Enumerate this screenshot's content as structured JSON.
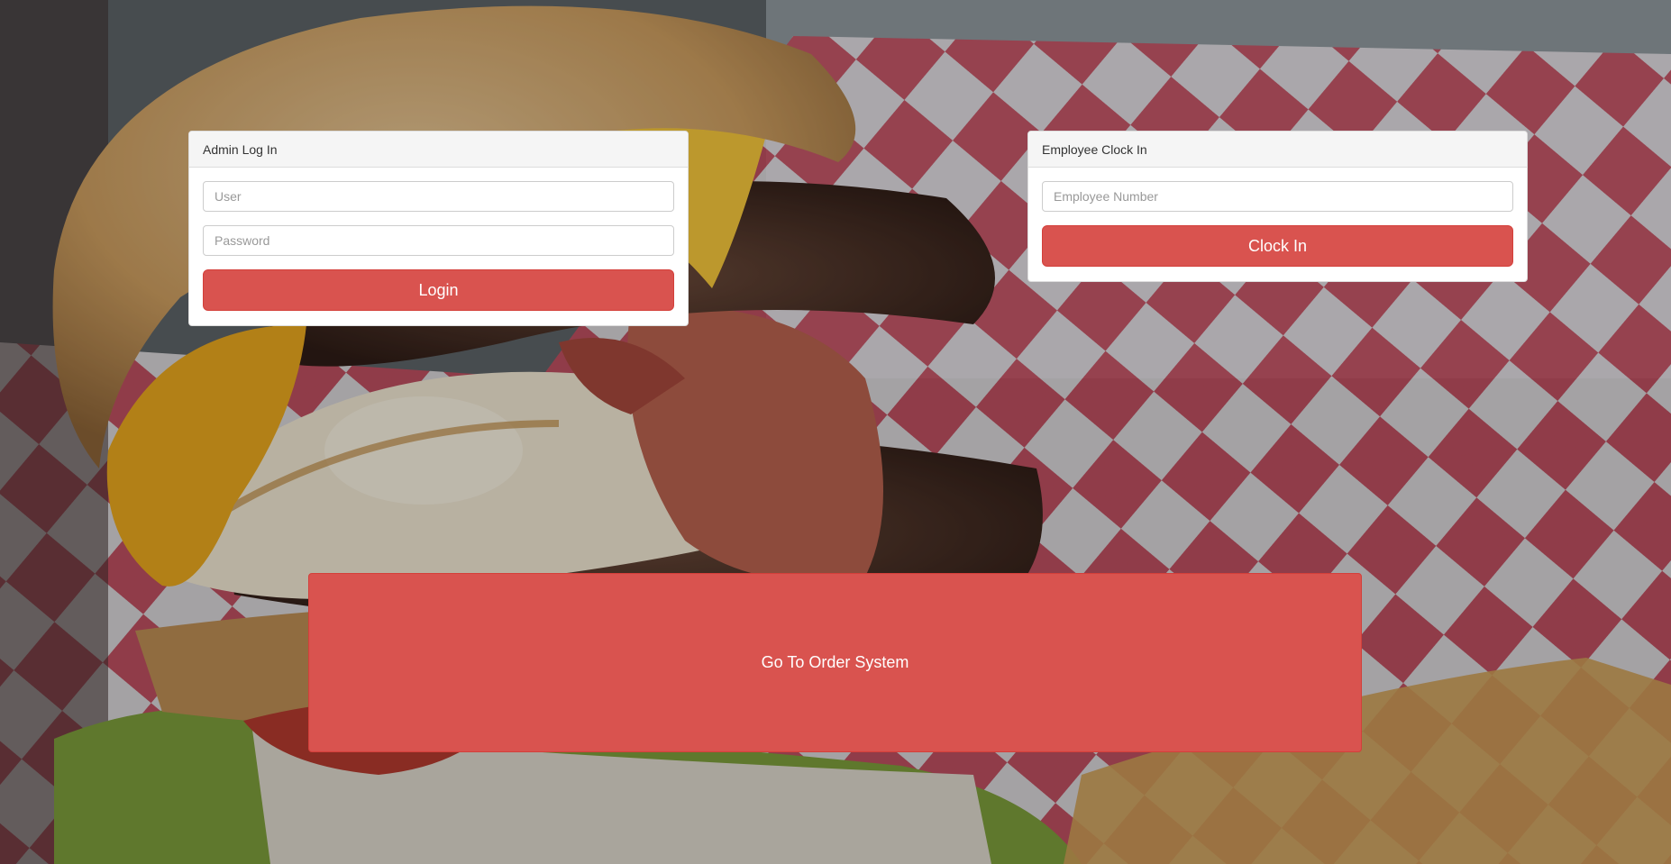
{
  "admin": {
    "title": "Admin Log In",
    "user_placeholder": "User",
    "password_placeholder": "Password",
    "login_label": "Login"
  },
  "employee": {
    "title": "Employee Clock In",
    "number_placeholder": "Employee Number",
    "clock_in_label": "Clock In"
  },
  "order": {
    "label": "Go To Order System"
  },
  "colors": {
    "accent": "#d9534f",
    "panel_heading_bg": "#f5f5f5"
  }
}
